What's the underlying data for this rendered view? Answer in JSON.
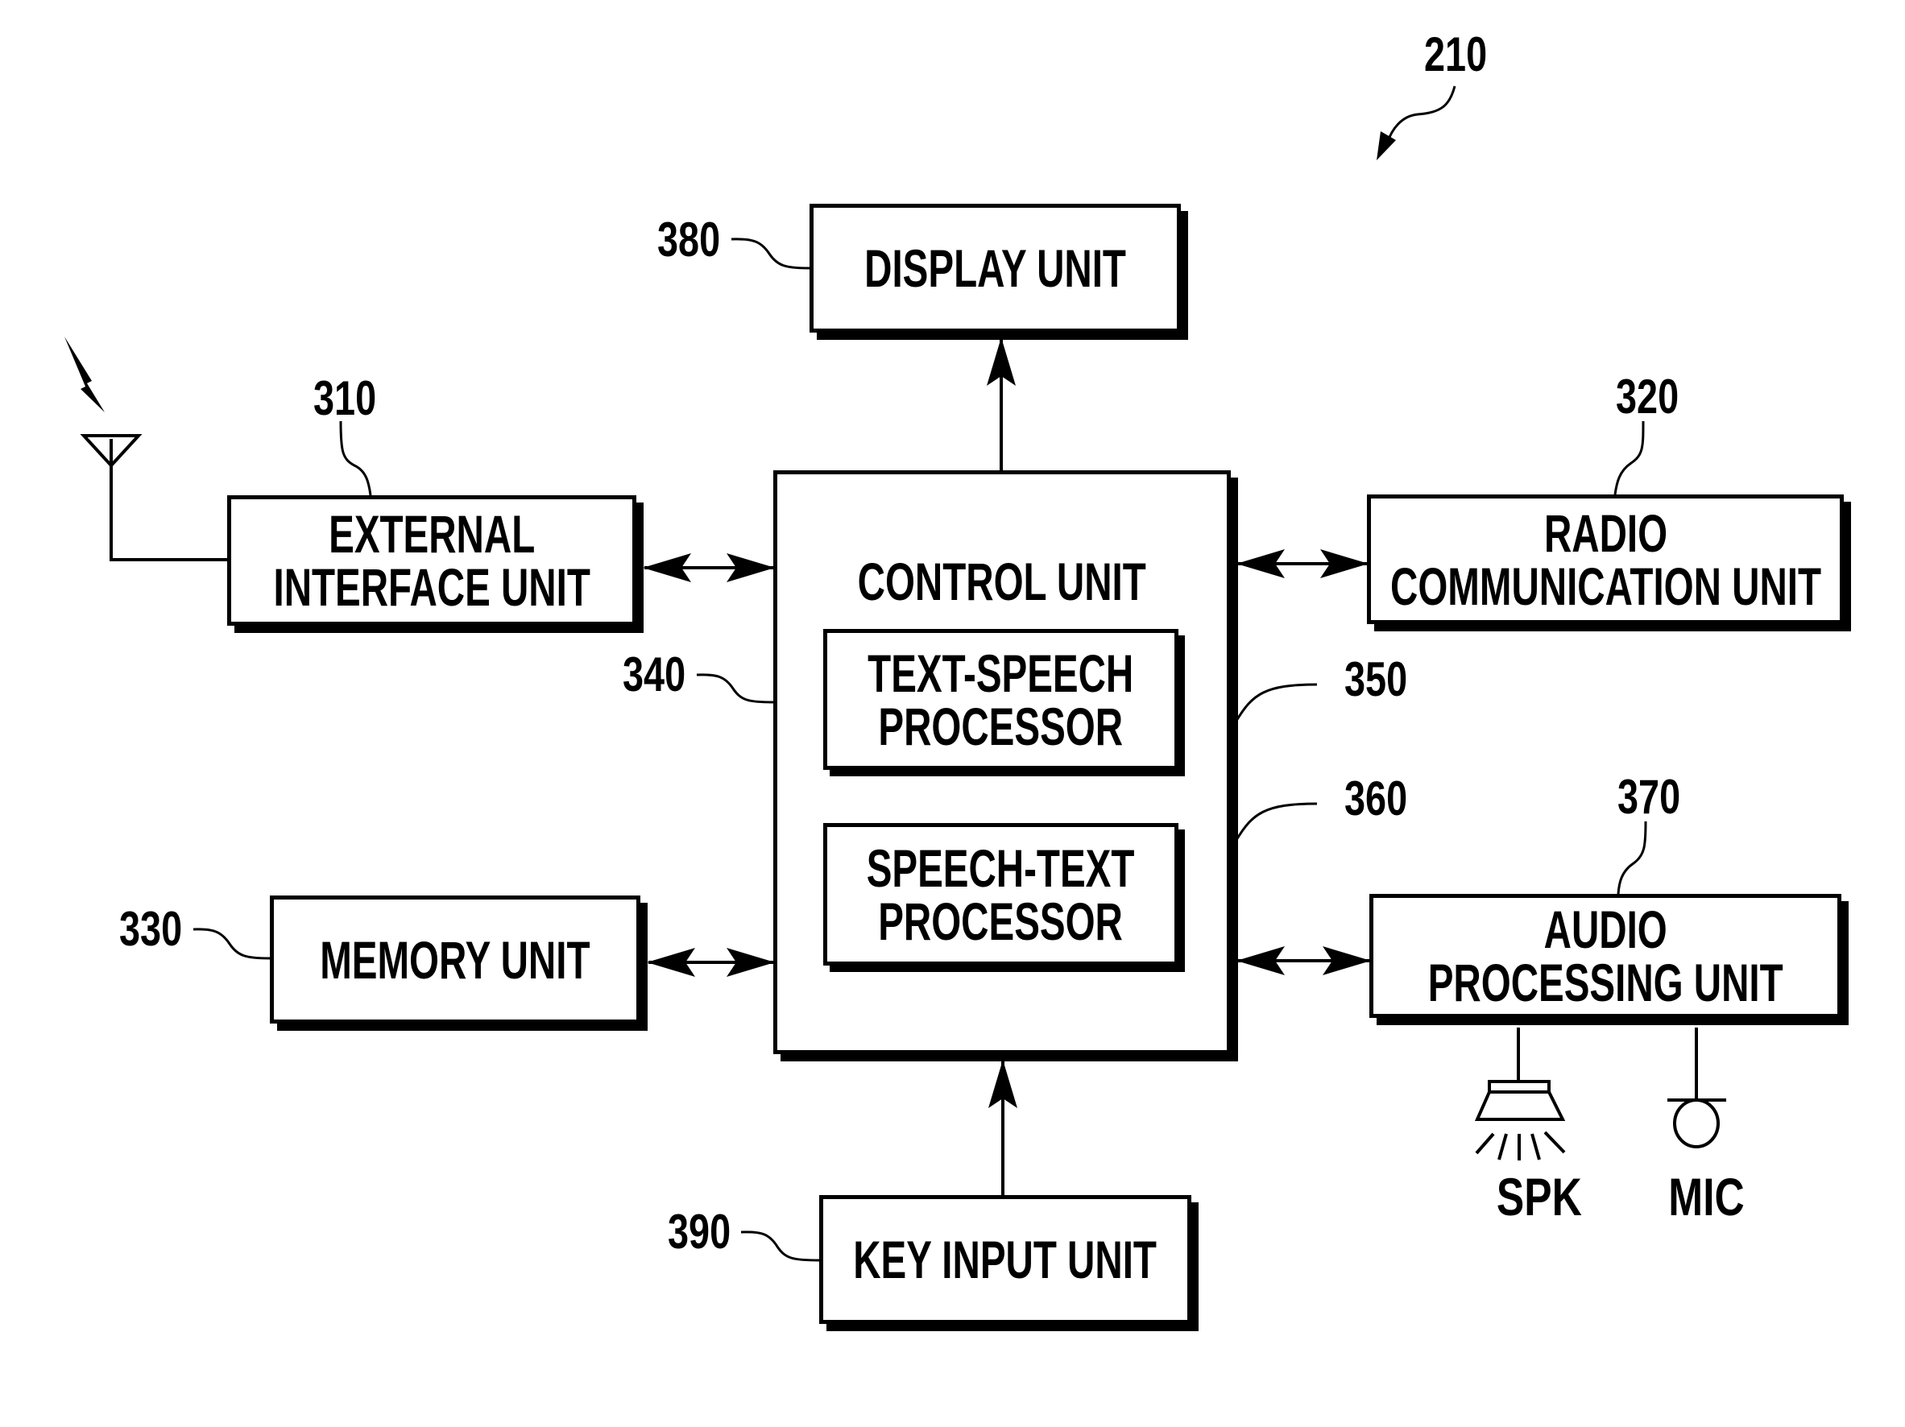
{
  "figure": {
    "reference": "210",
    "colors": {
      "ink": "#000000",
      "paper": "#ffffff"
    }
  },
  "blocks": {
    "display": {
      "ref": "380",
      "label": "DISPLAY UNIT"
    },
    "external": {
      "ref": "310",
      "label": "EXTERNAL\nINTERFACE UNIT"
    },
    "radio": {
      "ref": "320",
      "label": "RADIO\nCOMMUNICATION UNIT"
    },
    "memory": {
      "ref": "330",
      "label": "MEMORY UNIT"
    },
    "control": {
      "ref": "340",
      "label": "CONTROL UNIT"
    },
    "text_speech": {
      "ref": "350",
      "label": "TEXT-SPEECH\nPROCESSOR"
    },
    "speech_text": {
      "ref": "360",
      "label": "SPEECH-TEXT\nPROCESSOR"
    },
    "audio": {
      "ref": "370",
      "label": "AUDIO\nPROCESSING UNIT"
    },
    "key_input": {
      "ref": "390",
      "label": "KEY INPUT UNIT"
    }
  },
  "peripherals": {
    "speaker": {
      "label": "SPK",
      "icon": "speaker-icon"
    },
    "microphone": {
      "label": "MIC",
      "icon": "microphone-icon"
    },
    "antenna": {
      "icon": "antenna-icon",
      "signal_icon": "lightning-signal-icon"
    }
  },
  "connections": [
    {
      "from": "control",
      "to": "display",
      "direction": "one-way"
    },
    {
      "from": "external",
      "to": "control",
      "direction": "bidirectional"
    },
    {
      "from": "radio",
      "to": "control",
      "direction": "bidirectional"
    },
    {
      "from": "memory",
      "to": "control",
      "direction": "bidirectional"
    },
    {
      "from": "audio",
      "to": "control",
      "direction": "bidirectional"
    },
    {
      "from": "key_input",
      "to": "control",
      "direction": "one-way"
    },
    {
      "from": "antenna",
      "to": "external",
      "direction": "wire"
    },
    {
      "from": "audio",
      "to": "speaker",
      "direction": "wire"
    },
    {
      "from": "audio",
      "to": "microphone",
      "direction": "wire"
    }
  ]
}
